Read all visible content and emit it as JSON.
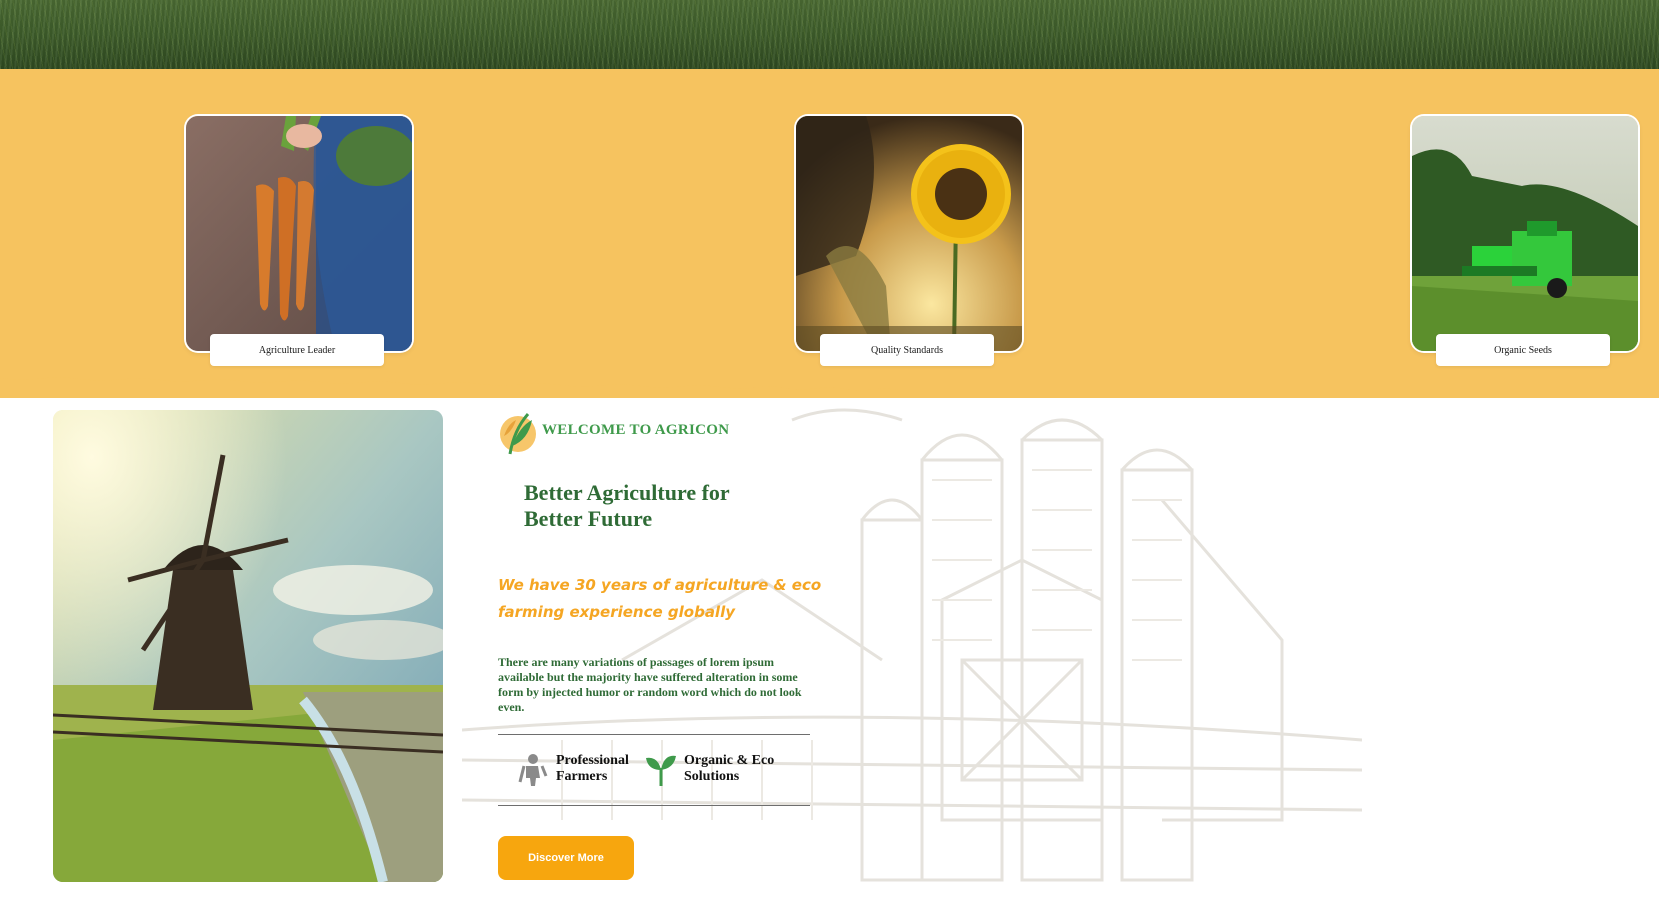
{
  "feature_cards": [
    {
      "label": "Agriculture Leader",
      "image": "carrots-photo"
    },
    {
      "label": "Quality Standards",
      "image": "sunflower-photo"
    },
    {
      "label": "Organic Seeds",
      "image": "harvester-photo"
    }
  ],
  "about": {
    "subtitle": "WELCOME TO AGRICON",
    "heading_line1": "Better Agriculture for",
    "heading_line2": "Better Future",
    "tagline_line1": "We have 30 years of agriculture & eco",
    "tagline_line2": "farming experience globally",
    "description": "There are many variations of passages of lorem ipsum available but the majority have suffered alteration in some form by injected humor or random word which do not look even.",
    "features": [
      {
        "line1": "Professional",
        "line2": "Farmers",
        "icon": "farmer-icon"
      },
      {
        "line1": "Organic & Eco",
        "line2": "Solutions",
        "icon": "leaf-icon"
      }
    ],
    "button_label": "Discover More"
  },
  "colors": {
    "band_yellow": "#f6c35f",
    "heading_green": "#2f6b36",
    "accent_green": "#3f9a4b",
    "accent_orange": "#f5a623",
    "button_orange": "#f7a60e"
  }
}
